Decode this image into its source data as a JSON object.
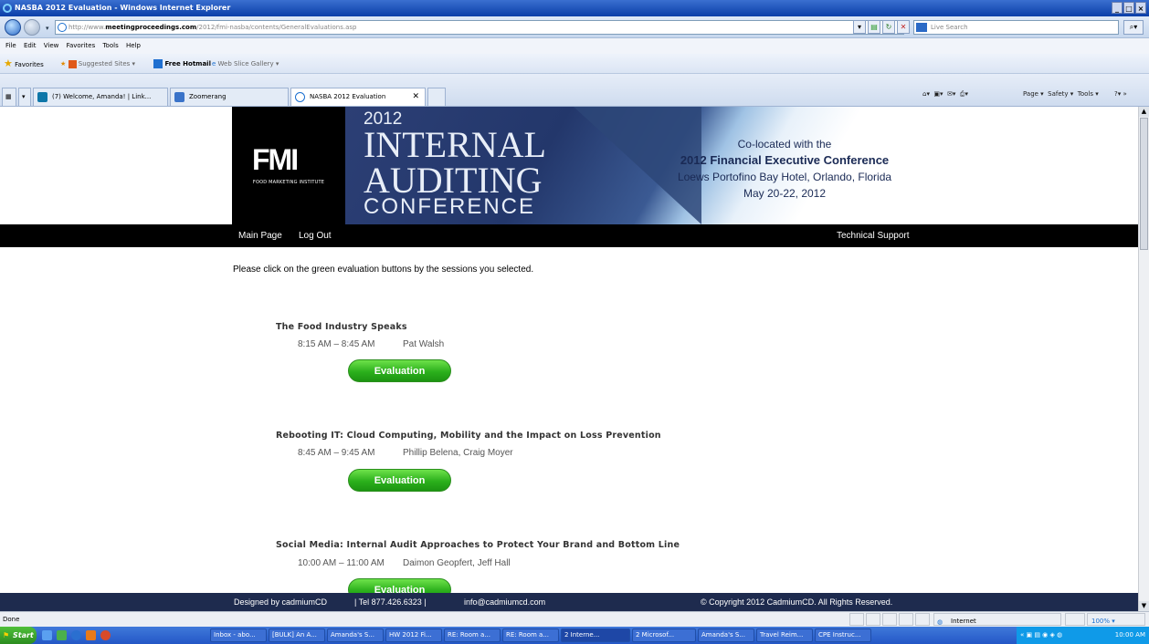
{
  "window": {
    "title": "NASBA 2012 Evaluation - Windows Internet Explorer",
    "controls": [
      "_",
      "□",
      "×"
    ]
  },
  "address": {
    "prefix": "http://www.",
    "domain": "meetingproceedings.com",
    "path": "/2012/fmi-nasba/contents/GeneralEvaluations.asp",
    "search_placeholder": "Live Search"
  },
  "menu": [
    "File",
    "Edit",
    "View",
    "Favorites",
    "Tools",
    "Help"
  ],
  "favorites": {
    "label": "Favorites",
    "items": [
      "Suggested Sites ▾",
      "Free Hotmail",
      "Web Slice Gallery ▾"
    ]
  },
  "tabs": [
    {
      "label": "(7) Welcome, Amanda! | Link...",
      "color": "#0e76a8"
    },
    {
      "label": "Zoomerang",
      "color": "#3a73c9"
    },
    {
      "label": "NASBA 2012 Evaluation",
      "color": "#1a6fd0"
    }
  ],
  "command_bar": {
    "items": [
      "Page ▾",
      "Safety ▾",
      "Tools ▾"
    ]
  },
  "banner": {
    "org_logo": "FMI",
    "org_name": "FOOD MARKETING INSTITUTE",
    "year": "2012",
    "line1": "INTERNAL",
    "line2": "AUDITING",
    "line3": "CONFERENCE",
    "coloc1": "Co-located with the",
    "coloc2": "2012 Financial Executive Conference",
    "coloc3": "Loews Portofino Bay Hotel, Orlando, Florida",
    "coloc4": "May 20-22, 2012"
  },
  "nav": {
    "main": "Main Page",
    "logout": "Log Out",
    "support": "Technical Support"
  },
  "intro": "Please click on the green evaluation buttons by the sessions you selected.",
  "sessions": [
    {
      "title": "The Food Industry Speaks",
      "time": "8:15 AM – 8:45 AM",
      "speaker": "Pat Walsh",
      "button": "Evaluation"
    },
    {
      "title": "Rebooting IT: Cloud Computing, Mobility and the Impact on Loss Prevention",
      "time": "8:45 AM – 9:45 AM",
      "speaker": "Phillip Belena, Craig Moyer",
      "button": "Evaluation"
    },
    {
      "title": "Social Media: Internal Audit Approaches to Protect Your Brand and Bottom Line",
      "time": "10:00 AM – 11:00 AM",
      "speaker": "Daimon Geopfert, Jeff Hall",
      "button": "Evaluation"
    }
  ],
  "footer": {
    "designer": "Designed by cadmiumCD",
    "phone": "| Tel 877.426.6323 |",
    "email": "info@cadmiumcd.com",
    "copyright": "© Copyright 2012 CadmiumCD. All Rights Reserved."
  },
  "status": {
    "left": "Done",
    "zone": "Internet",
    "zoom": "â 100%"
  },
  "taskbar": {
    "start": "Start",
    "buttons": [
      "Inbox - abo...",
      "[BULK] An A...",
      "Amanda's S...",
      "HW 2012 Fi...",
      "RE: Room a...",
      "RE: Room a...",
      "2 Interne...",
      "2 Microsof...",
      "Amanda's S...",
      "Travel Reim...",
      "CPE Instruc..."
    ],
    "clock": "10:00 AM"
  }
}
